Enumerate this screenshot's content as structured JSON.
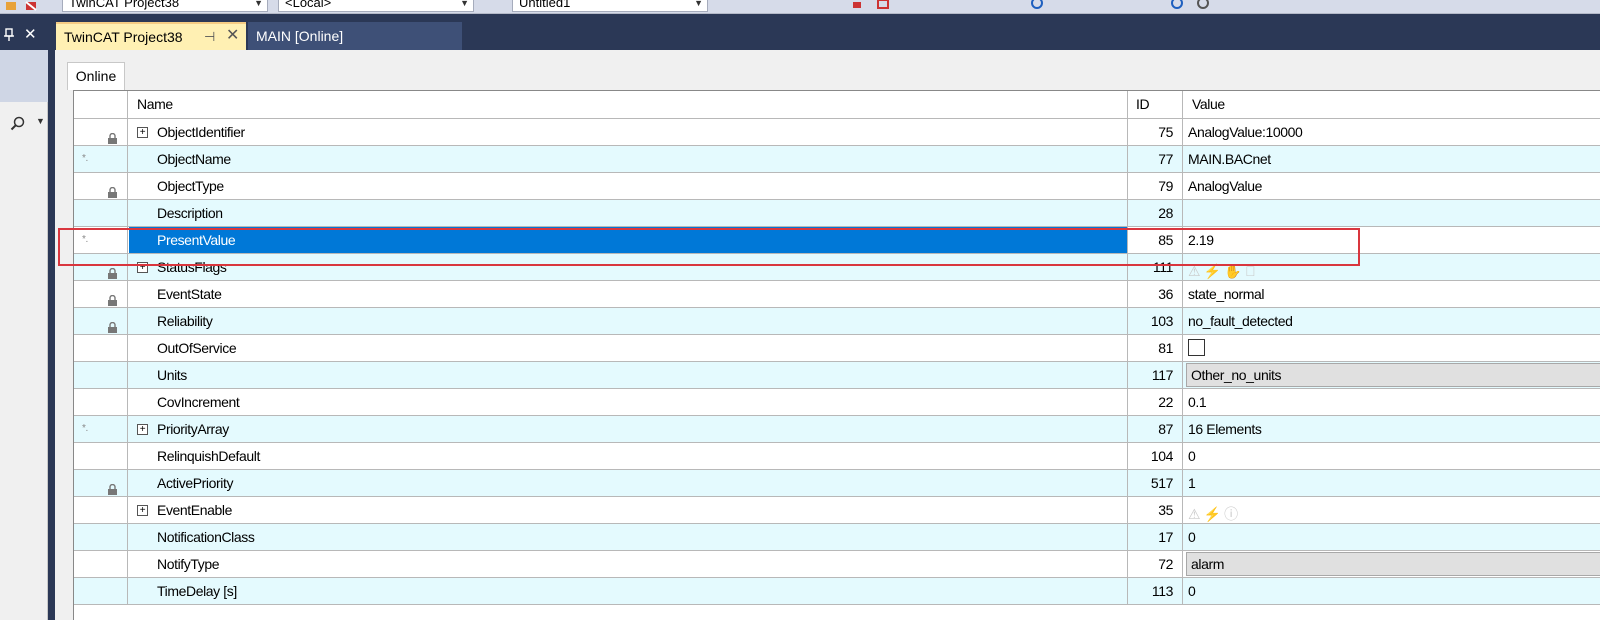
{
  "toolbar": {
    "project_combo": "TwinCAT Project38",
    "target_combo": "<Local>",
    "config_combo": "Untitled1"
  },
  "left_panel": {
    "pin_glyph": "ꟷ",
    "close_glyph": "✕"
  },
  "tabs": [
    {
      "label": "TwinCAT Project38",
      "active": true
    },
    {
      "label": "MAIN [Online]",
      "active": false
    }
  ],
  "subtab": {
    "label": "Online"
  },
  "grid": {
    "headers": {
      "name": "Name",
      "id": "ID",
      "value": "Value"
    },
    "rows": [
      {
        "name": "ObjectIdentifier",
        "id": "75",
        "value": "AnalogValue:10000",
        "lock": true,
        "expand": true,
        "star": false
      },
      {
        "name": "ObjectName",
        "id": "77",
        "value": "MAIN.BACnet",
        "lock": false,
        "expand": false,
        "star": true
      },
      {
        "name": "ObjectType",
        "id": "79",
        "value": "AnalogValue",
        "lock": true,
        "expand": false,
        "star": false
      },
      {
        "name": "Description",
        "id": "28",
        "value": "",
        "lock": false,
        "expand": false,
        "star": false
      },
      {
        "name": "PresentValue",
        "id": "85",
        "value": "2.19",
        "lock": false,
        "expand": false,
        "star": true,
        "selected": true
      },
      {
        "name": "StatusFlags",
        "id": "111",
        "value": "",
        "lock": true,
        "expand": true,
        "star": false,
        "flags": "⚠ ⚡ ✋ ⃠"
      },
      {
        "name": "EventState",
        "id": "36",
        "value": "state_normal",
        "lock": true,
        "expand": false,
        "star": false
      },
      {
        "name": "Reliability",
        "id": "103",
        "value": "no_fault_detected",
        "lock": true,
        "expand": false,
        "star": false
      },
      {
        "name": "OutOfService",
        "id": "81",
        "value": "",
        "lock": false,
        "expand": false,
        "star": false,
        "checkbox": true
      },
      {
        "name": "Units",
        "id": "117",
        "value": "Other_no_units",
        "lock": false,
        "expand": false,
        "star": false,
        "gray": true
      },
      {
        "name": "CovIncrement",
        "id": "22",
        "value": "0.1",
        "lock": false,
        "expand": false,
        "star": false
      },
      {
        "name": "PriorityArray",
        "id": "87",
        "value": "16 Elements",
        "lock": false,
        "expand": true,
        "star": true
      },
      {
        "name": "RelinquishDefault",
        "id": "104",
        "value": "0",
        "lock": false,
        "expand": false,
        "star": false
      },
      {
        "name": "ActivePriority",
        "id": "517",
        "value": "1",
        "lock": true,
        "expand": false,
        "star": false
      },
      {
        "name": "EventEnable",
        "id": "35",
        "value": "",
        "lock": false,
        "expand": true,
        "star": false,
        "flags": "⚠ ⚡ ⓘ"
      },
      {
        "name": "NotificationClass",
        "id": "17",
        "value": "0",
        "lock": false,
        "expand": false,
        "star": false
      },
      {
        "name": "NotifyType",
        "id": "72",
        "value": "alarm",
        "lock": false,
        "expand": false,
        "star": false,
        "gray": true
      },
      {
        "name": "TimeDelay [s]",
        "id": "113",
        "value": "0",
        "lock": false,
        "expand": false,
        "star": false
      }
    ]
  }
}
